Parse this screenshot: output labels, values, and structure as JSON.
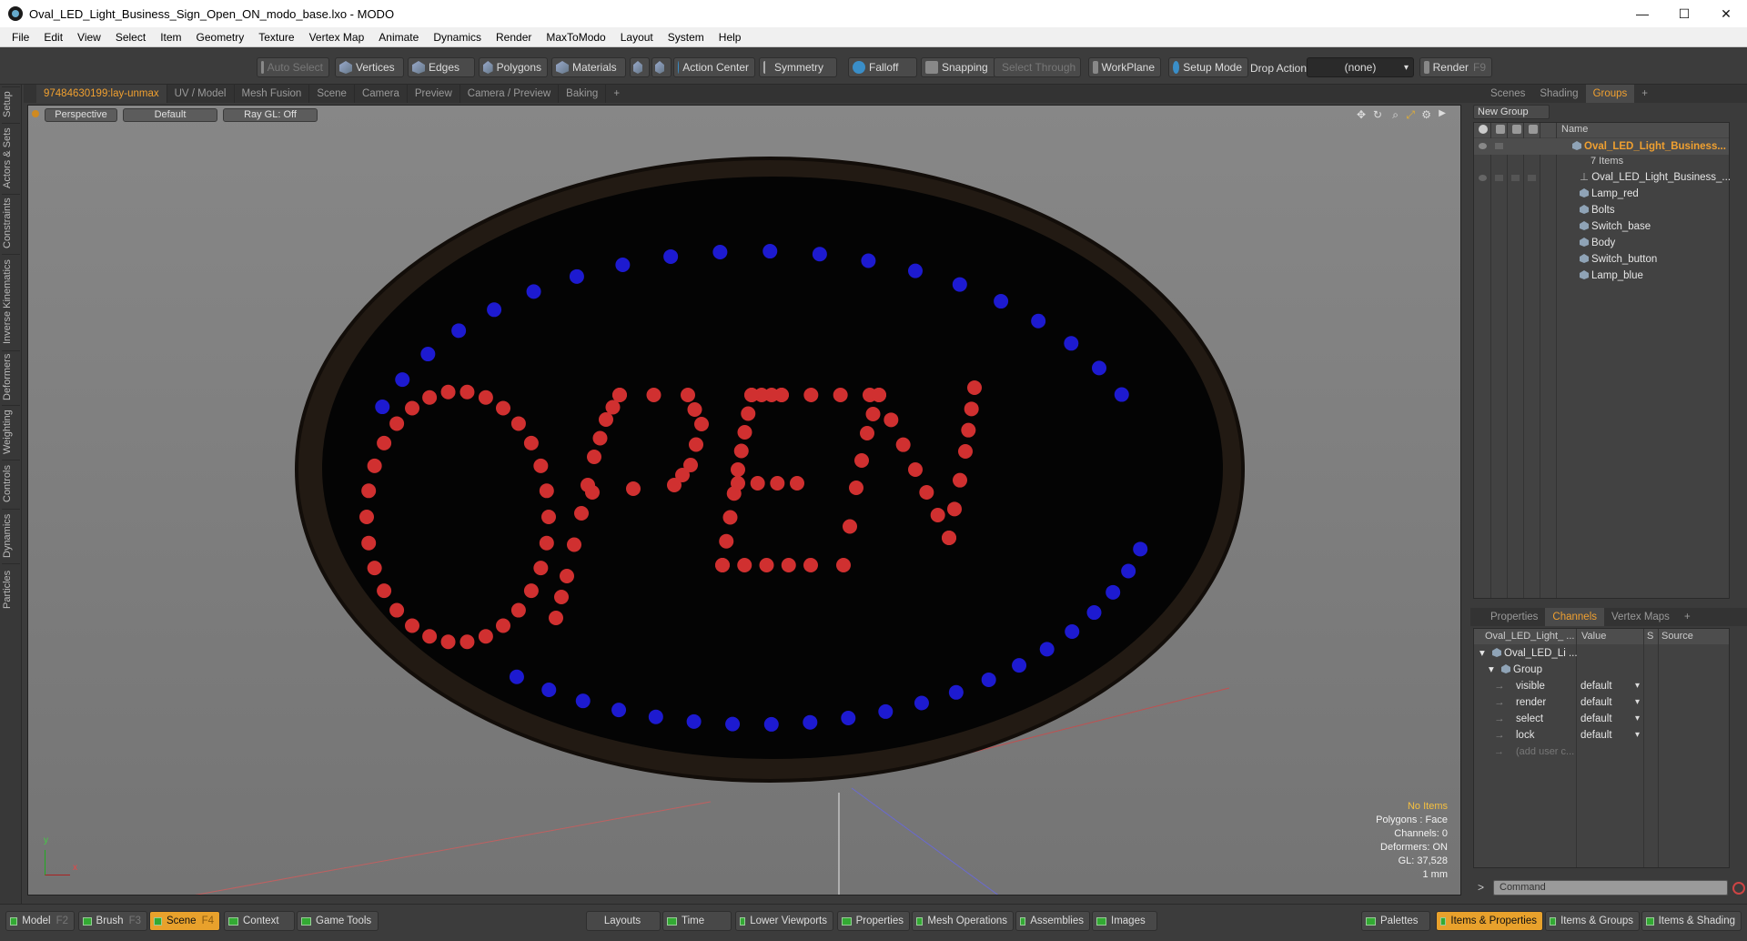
{
  "window": {
    "title": "Oval_LED_Light_Business_Sign_Open_ON_modo_base.lxo - MODO",
    "controls": [
      "—",
      "☐",
      "✕"
    ]
  },
  "menu": [
    "File",
    "Edit",
    "View",
    "Select",
    "Item",
    "Geometry",
    "Texture",
    "Vertex Map",
    "Animate",
    "Dynamics",
    "Render",
    "MaxToModo",
    "Layout",
    "System",
    "Help"
  ],
  "toolbar": {
    "auto_select": "Auto Select",
    "vertices": "Vertices",
    "edges": "Edges",
    "polygons": "Polygons",
    "materials": "Materials",
    "action_center": "Action Center",
    "symmetry": "Symmetry",
    "falloff": "Falloff",
    "snapping": "Snapping",
    "select_through": "Select Through",
    "workplane": "WorkPlane",
    "setup_mode": "Setup Mode",
    "drop_action": "Drop Action",
    "drop_value": "(none)",
    "render": "Render",
    "render_key": "F9"
  },
  "left_tabs": [
    "Setup",
    "Actors & Sets",
    "Constraints",
    "Inverse Kinematics",
    "Deformers",
    "Weighting",
    "Controls",
    "Dynamics",
    "Particles"
  ],
  "viewport_tabs": [
    "97484630199:lay-unmax",
    "UV / Model",
    "Mesh Fusion",
    "Scene",
    "Camera",
    "Preview",
    "Camera / Preview",
    "Baking",
    "+"
  ],
  "viewport": {
    "perspective": "Perspective",
    "style": "Default",
    "raygl": "Ray GL: Off",
    "sign_text": "OPEN",
    "info": {
      "items": "No Items",
      "polygons": "Polygons : Face",
      "channels": "Channels: 0",
      "deformers": "Deformers: ON",
      "gl": "GL: 37,528",
      "scale": "1 mm"
    },
    "axis_y": "y",
    "axis_x": "x",
    "colors": {
      "led_red": "#d03030",
      "led_blue": "#1d1ad0",
      "sign_body": "#050505",
      "sign_rim": "#251c14"
    }
  },
  "right_tabs": [
    "Scenes",
    "Shading",
    "Groups",
    "+"
  ],
  "groups": {
    "new_group": "New Group",
    "name_header": "Name",
    "root": "Oval_LED_Light_Business...",
    "root_count": "7 Items",
    "children": [
      "Oval_LED_Light_Business_...",
      "Lamp_red",
      "Bolts",
      "Switch_base",
      "Body",
      "Switch_button",
      "Lamp_blue"
    ]
  },
  "lower_tabs": [
    "Properties",
    "Channels",
    "Vertex Maps",
    "+"
  ],
  "channels": {
    "col_name": "Oval_LED_Light_ ...",
    "col_value": "Value",
    "col_s": "S",
    "col_source": "Source",
    "item": "Oval_LED_Li ...",
    "group": "Group",
    "rows": [
      {
        "name": "visible",
        "value": "default"
      },
      {
        "name": "render",
        "value": "default"
      },
      {
        "name": "select",
        "value": "default"
      },
      {
        "name": "lock",
        "value": "default"
      }
    ],
    "add_user": "(add user c..."
  },
  "command": {
    "prompt": ">",
    "placeholder": "Command"
  },
  "bottom": {
    "model": "Model",
    "model_key": "F2",
    "brush": "Brush",
    "brush_key": "F3",
    "scene": "Scene",
    "scene_key": "F4",
    "context": "Context",
    "game_tools": "Game Tools",
    "layouts": "Layouts",
    "time": "Time",
    "lower_viewports": "Lower Viewports",
    "properties": "Properties",
    "mesh_operations": "Mesh Operations",
    "assemblies": "Assemblies",
    "images": "Images",
    "palettes": "Palettes",
    "items_properties": "Items & Properties",
    "items_groups": "Items & Groups",
    "items_shading": "Items & Shading"
  }
}
